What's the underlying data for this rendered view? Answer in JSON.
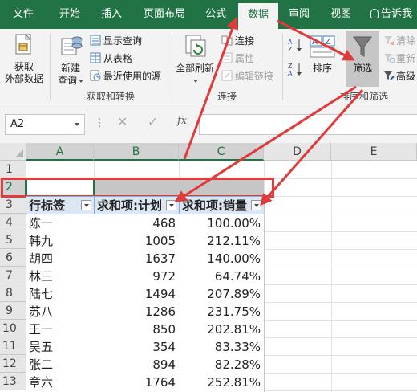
{
  "tabs": {
    "file": "文件",
    "home": "开始",
    "insert": "插入",
    "page_layout": "页面布局",
    "formulas": "公式",
    "data": "数据",
    "review": "审阅",
    "view": "视图",
    "tell_me": "告诉我"
  },
  "ribbon": {
    "get_transform": {
      "get_external_data": "获取\n外部数据",
      "new_query": "新建\n查询",
      "show_queries": "显示查询",
      "from_table": "从表格",
      "recent_sources": "最近使用的源",
      "group_label": "获取和转换"
    },
    "connections": {
      "refresh_all": "全部刷新",
      "connections": "连接",
      "properties": "属性",
      "edit_links": "编辑链接",
      "group_label": "连接"
    },
    "sort_filter": {
      "sort": "排序",
      "filter": "筛选",
      "clear": "清除",
      "reapply": "重新",
      "advanced": "高级",
      "group_label": "排序和筛选"
    }
  },
  "formula_bar": {
    "name_box": "A2",
    "formula": "",
    "fx_label": "fx",
    "cancel": "✕",
    "enter": "✓",
    "dots": "⋮"
  },
  "sheet": {
    "columns": [
      "A",
      "B",
      "C",
      "D",
      "E"
    ],
    "rows": [
      "1",
      "2",
      "3",
      "4",
      "5",
      "6",
      "7",
      "8",
      "9",
      "10",
      "11",
      "12",
      "13"
    ],
    "pivot_headers": [
      "行标签",
      "求和项:计划",
      "求和项:销量"
    ],
    "pivot_rows": [
      {
        "label": "陈一",
        "plan": "468",
        "sales": "100.00%"
      },
      {
        "label": "韩九",
        "plan": "1005",
        "sales": "212.11%"
      },
      {
        "label": "胡四",
        "plan": "1637",
        "sales": "140.00%"
      },
      {
        "label": "林三",
        "plan": "972",
        "sales": "64.74%"
      },
      {
        "label": "陆七",
        "plan": "1494",
        "sales": "207.89%"
      },
      {
        "label": "苏八",
        "plan": "1286",
        "sales": "231.75%"
      },
      {
        "label": "王一",
        "plan": "850",
        "sales": "202.81%"
      },
      {
        "label": "吴五",
        "plan": "354",
        "sales": "83.33%"
      },
      {
        "label": "张二",
        "plan": "894",
        "sales": "82.28%"
      },
      {
        "label": "章六",
        "plan": "1764",
        "sales": "252.81%"
      }
    ]
  },
  "colors": {
    "ribbon_green": "#217346",
    "annotation_red": "#e03a3a",
    "pivot_header_fill": "#dde6f3"
  }
}
